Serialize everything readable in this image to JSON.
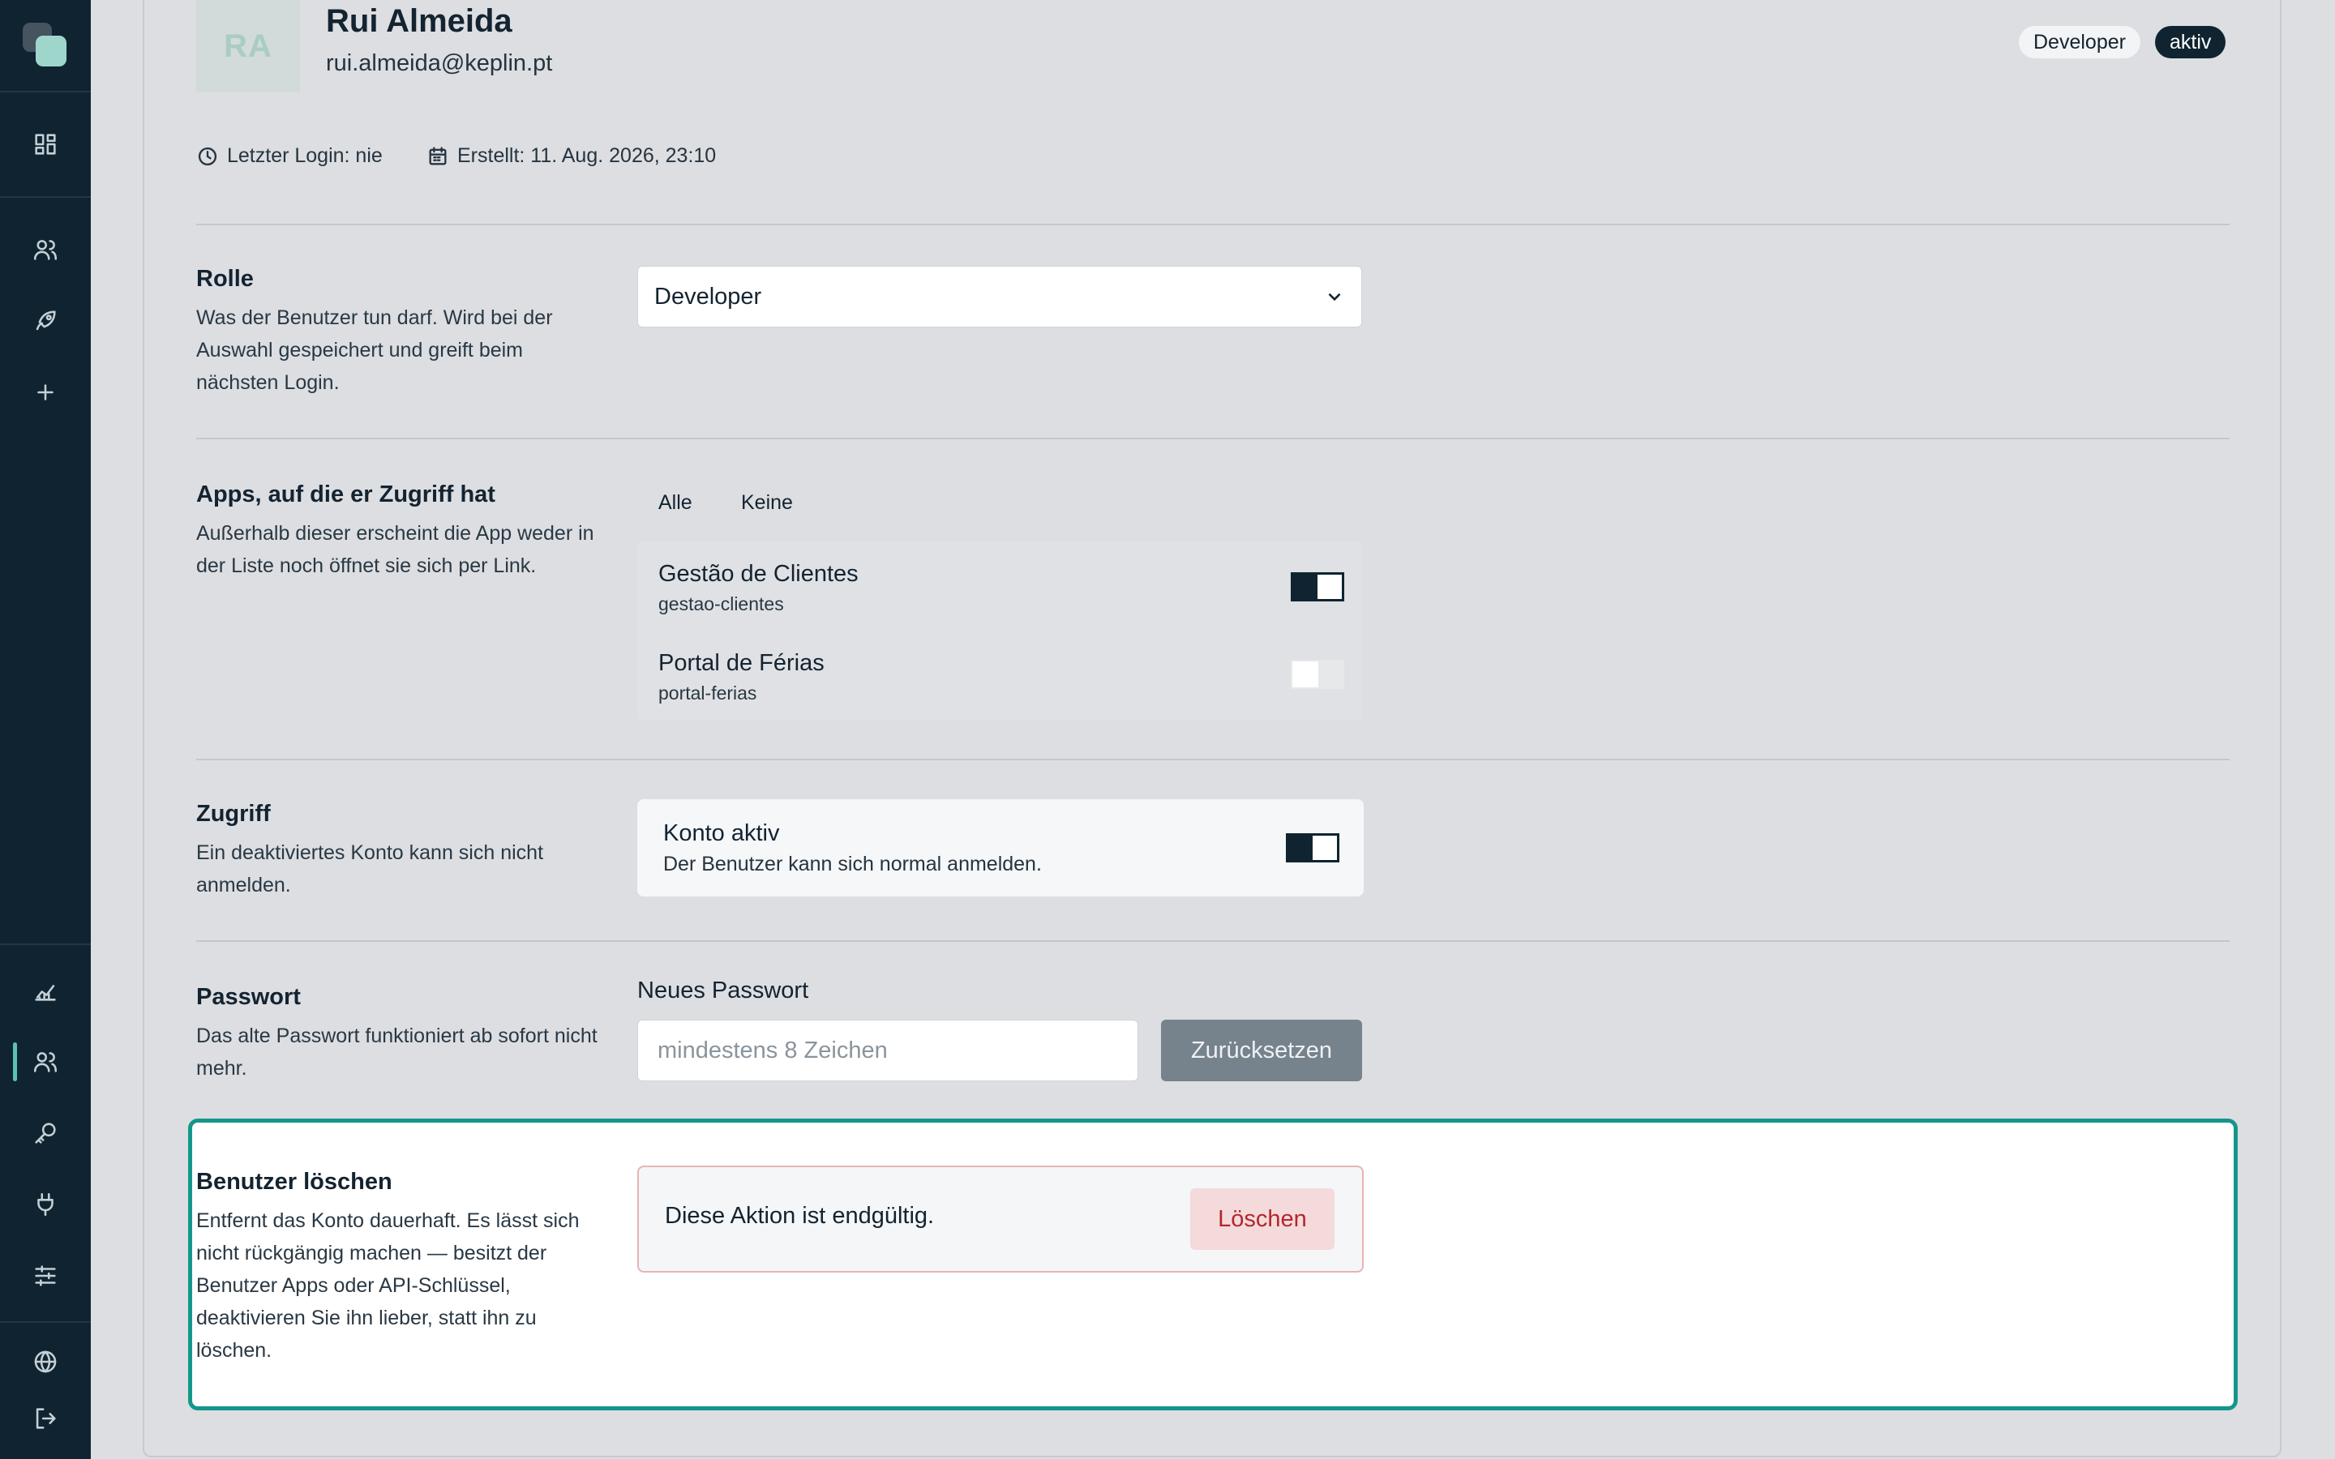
{
  "sidebar": {
    "items": [
      {
        "icon": "dashboard-icon"
      },
      {
        "icon": "users-icon"
      },
      {
        "icon": "rocket-icon"
      },
      {
        "icon": "plus-icon"
      },
      {
        "icon": "analytics-icon"
      },
      {
        "icon": "users-icon",
        "active": true
      },
      {
        "icon": "key-icon"
      },
      {
        "icon": "plug-icon"
      },
      {
        "icon": "sliders-icon"
      },
      {
        "icon": "globe-icon"
      },
      {
        "icon": "logout-icon"
      }
    ]
  },
  "user": {
    "initials": "RA",
    "name": "Rui Almeida",
    "email": "rui.almeida@keplin.pt",
    "role_badge": "Developer",
    "status_badge": "aktiv",
    "last_login": "Letzter Login: nie",
    "created": "Erstellt: 11. Aug. 2026, 23:10"
  },
  "role_section": {
    "title": "Rolle",
    "description": "Was der Benutzer tun darf. Wird bei der Auswahl gespeichert und greift beim nächsten Login.",
    "selected": "Developer"
  },
  "apps_section": {
    "title": "Apps, auf die er Zugriff hat",
    "description": "Außerhalb dieser erscheint die App weder in der Liste noch öffnet sie sich per Link.",
    "select_all": "Alle",
    "select_none": "Keine",
    "apps": [
      {
        "name": "Gestão de Clientes",
        "slug": "gestao-clientes",
        "enabled": true
      },
      {
        "name": "Portal de Férias",
        "slug": "portal-ferias",
        "enabled": false
      }
    ]
  },
  "access_section": {
    "title": "Zugriff",
    "description": "Ein deaktiviertes Konto kann sich nicht anmelden.",
    "toggle_title": "Konto aktiv",
    "toggle_desc": "Der Benutzer kann sich normal anmelden.",
    "enabled": true
  },
  "password_section": {
    "title": "Passwort",
    "description": "Das alte Passwort funktioniert ab sofort nicht mehr.",
    "field_label": "Neues Passwort",
    "placeholder": "mindestens 8 Zeichen",
    "value": "",
    "reset_label": "Zurücksetzen"
  },
  "delete_section": {
    "title": "Benutzer löschen",
    "description": "Entfernt das Konto dauerhaft. Es lässt sich nicht rückgängig machen — besitzt der Benutzer Apps oder API-Schlüssel, deaktivieren Sie ihn lieber, statt ihn zu löschen.",
    "warning": "Diese Aktion ist endgültig.",
    "delete_label": "Löschen"
  },
  "colors": {
    "sidebar_bg": "#0f2430",
    "accent": "#14968a",
    "danger": "#b3262e"
  }
}
